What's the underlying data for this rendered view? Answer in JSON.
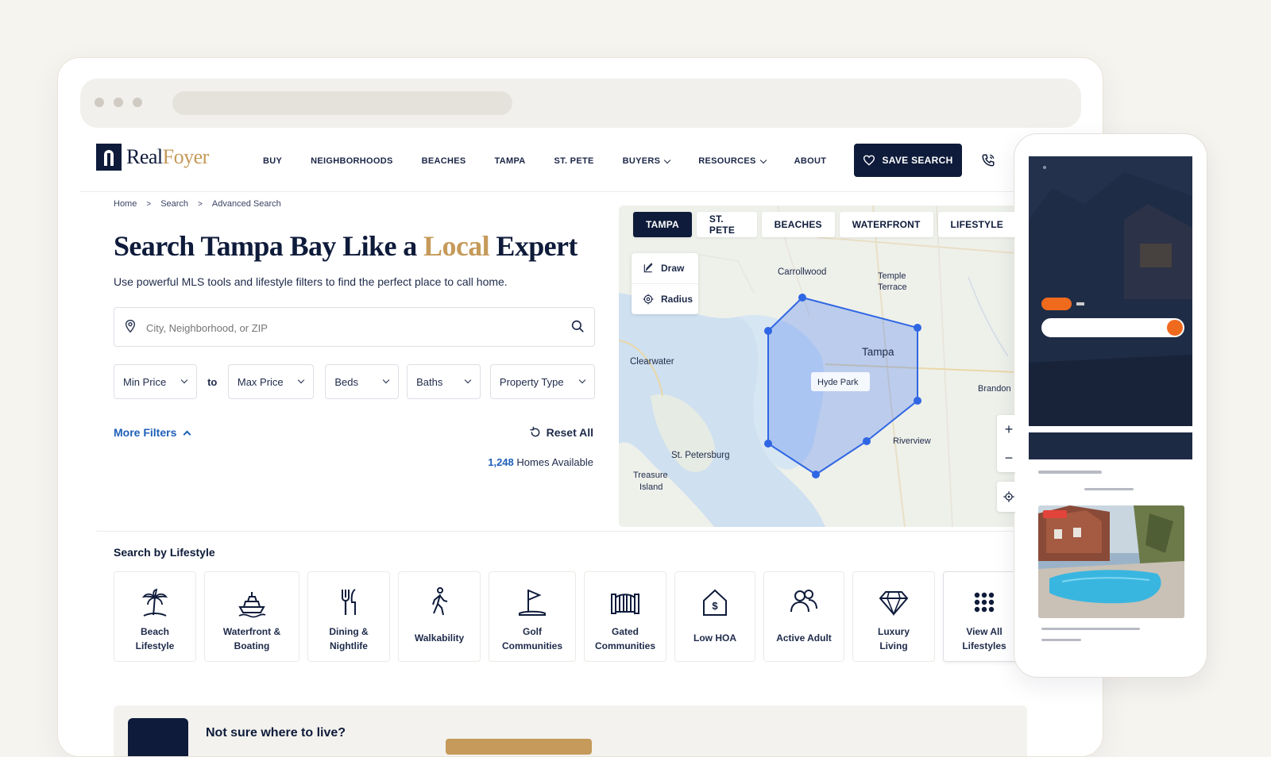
{
  "brand": {
    "name_part1": "Real",
    "name_part2": "Foyer",
    "accent_color": "#c59a5a",
    "navy": "#0e1b3a"
  },
  "nav": {
    "items": [
      {
        "label": "BUY",
        "dropdown": false
      },
      {
        "label": "NEIGHBORHOODS",
        "dropdown": false
      },
      {
        "label": "BEACHES",
        "dropdown": false
      },
      {
        "label": "TAMPA",
        "dropdown": false
      },
      {
        "label": "ST. PETE",
        "dropdown": false
      },
      {
        "label": "BUYERS",
        "dropdown": true
      },
      {
        "label": "RESOURCES",
        "dropdown": true
      },
      {
        "label": "ABOUT",
        "dropdown": false
      }
    ],
    "save_search": "SAVE SEARCH",
    "phone_icon": "phone-icon"
  },
  "breadcrumb": [
    "Home",
    "Search",
    "Advanced Search"
  ],
  "hero": {
    "title_before": "Search Tampa Bay Like a ",
    "title_accent": "Local",
    "title_after": " Expert",
    "subtitle": "Use powerful MLS tools and lifestyle filters to find the perfect place to call home."
  },
  "search": {
    "placeholder": "City, Neighborhood, or ZIP",
    "value": ""
  },
  "filters": {
    "min_price": "Min Price",
    "to": "to",
    "max_price": "Max Price",
    "beds": "Beds",
    "baths": "Baths",
    "property_type": "Property Type"
  },
  "more_filters": "More Filters",
  "reset_all": "Reset All",
  "homes": {
    "count": "1,248",
    "label": " Homes Available"
  },
  "map": {
    "tabs": [
      "TAMPA",
      "ST. PETE",
      "BEACHES",
      "WATERFRONT",
      "LIFESTYLE"
    ],
    "active_tab": "TAMPA",
    "tools": [
      "Draw",
      "Radius"
    ],
    "labels": {
      "carrollwood": "Carrollwood",
      "temple1": "Temple",
      "temple2": "Terrace",
      "clearwater": "Clearwater",
      "tampa": "Tampa",
      "hyde_park": "Hyde Park",
      "brandon": "Brandon",
      "riverview": "Riverview",
      "st_petersburg": "St. Petersburg",
      "treasure1": "Treasure",
      "treasure2": "Island"
    },
    "zoom_in": "+",
    "zoom_out": "−"
  },
  "lifestyle": {
    "title": "Search by Lifestyle",
    "items": [
      {
        "label": "Beach\nLifestyle",
        "icon": "palm-tree-icon"
      },
      {
        "label": "Waterfront &\nBoating",
        "icon": "boat-icon"
      },
      {
        "label": "Dining &\nNightlife",
        "icon": "fork-knife-icon"
      },
      {
        "label": "Walkability",
        "icon": "walking-person-icon"
      },
      {
        "label": "Golf\nCommunities",
        "icon": "golf-flag-icon"
      },
      {
        "label": "Gated\nCommunities",
        "icon": "gate-icon"
      },
      {
        "label": "Low HOA",
        "icon": "house-dollar-icon"
      },
      {
        "label": "Active Adult",
        "icon": "people-icon"
      },
      {
        "label": "Luxury\nLiving",
        "icon": "diamond-icon"
      },
      {
        "label": "View All\nLifestyles",
        "icon": "grid-dots-icon"
      }
    ]
  },
  "not_sure": {
    "text": "Not sure where to live?"
  }
}
